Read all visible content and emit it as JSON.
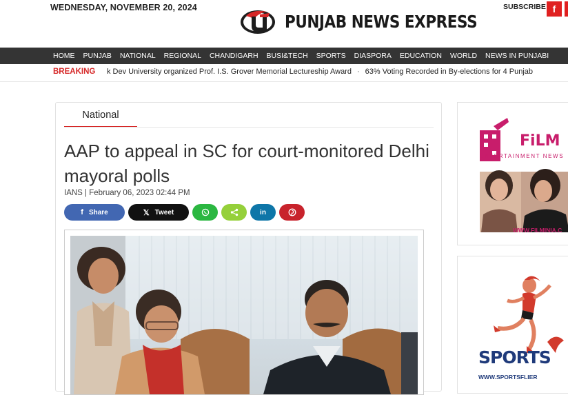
{
  "header": {
    "date": "WEDNESDAY, NOVEMBER 20, 2024",
    "site_name": "PUNJAB NEWS EXPRESS",
    "subscribe_label": "SUBSCRIBE",
    "facebook_glyph": "f"
  },
  "nav": {
    "items": [
      "HOME",
      "PUNJAB",
      "NATIONAL",
      "REGIONAL",
      "CHANDIGARH",
      "BUSI&TECH",
      "SPORTS",
      "DIASPORA",
      "EDUCATION",
      "WORLD",
      "NEWS IN PUNJABI"
    ]
  },
  "breaking": {
    "label": "BREAKING",
    "items": [
      "k Dev University organized Prof. I.S. Grover Memorial Lectureship Award",
      "63% Voting Recorded in By-elections for 4 Punjab"
    ]
  },
  "article": {
    "category": "National",
    "headline": "AAP to appeal in SC for court-monitored Delhi mayoral polls",
    "byline": "IANS | February 06, 2023 02:44 PM",
    "share": {
      "facebook": "Share",
      "twitter": "Tweet"
    }
  },
  "sidebar": {
    "ad1": {
      "brand": "FiLM",
      "tagline": "ENTERTAINMENT NEWS",
      "url": "WWW.FILMINIA.C"
    },
    "ad2": {
      "brand": "SPORTS",
      "url": "WWW.SPORTSFLIER"
    }
  },
  "colors": {
    "accent": "#d62828",
    "nav_bg": "#343434",
    "facebook": "#4267b2",
    "twitter": "#111111",
    "whatsapp": "#2bb741",
    "sharethis": "#95d03a",
    "linkedin": "#0e76a8",
    "pinterest": "#c8232c"
  }
}
